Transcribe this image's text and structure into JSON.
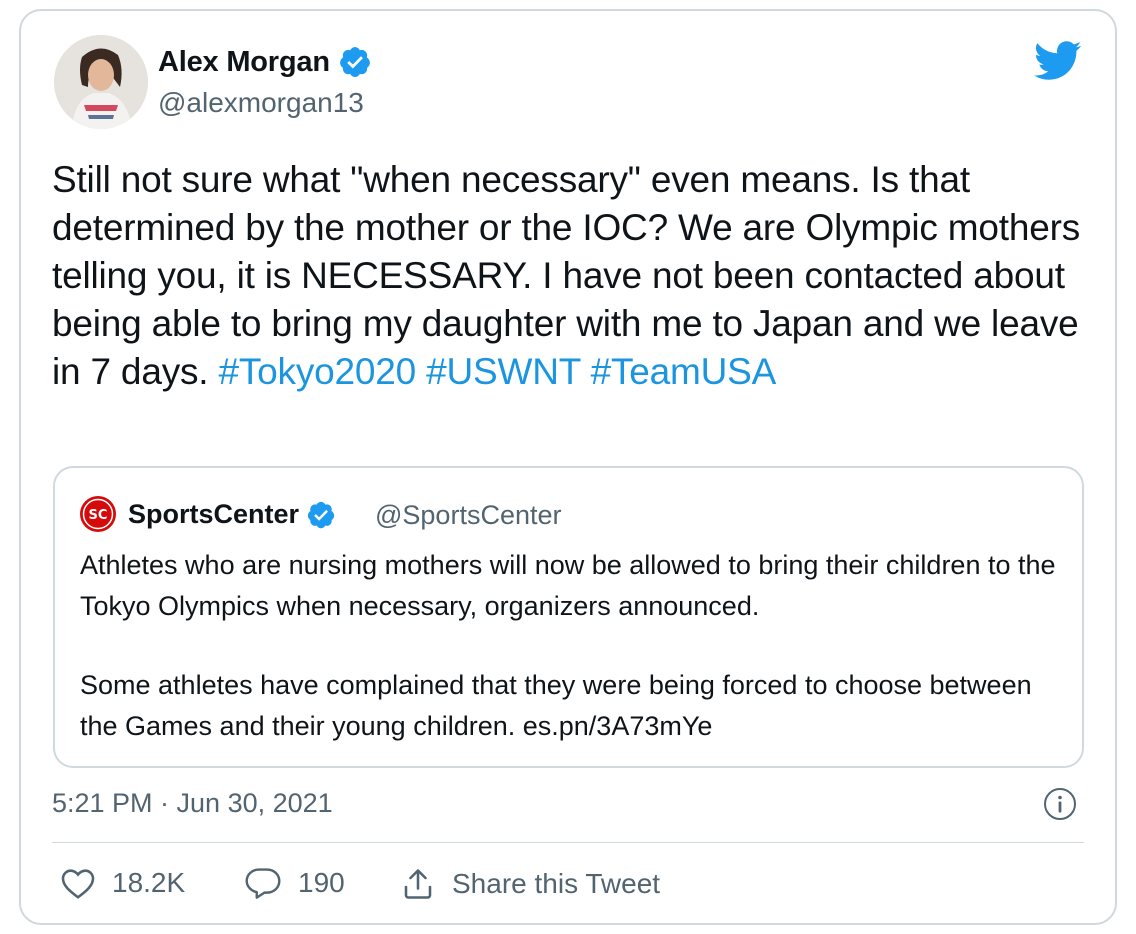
{
  "author": {
    "name": "Alex Morgan",
    "handle": "@alexmorgan13",
    "verified": true
  },
  "tweet": {
    "text_plain": "Still not sure what \"when necessary\" even means. Is that determined by the mother or the IOC? We are Olympic mothers telling you, it is NECESSARY. I have not been contacted about being able to bring my daughter with me to Japan and we leave in 7 days.",
    "hashtags": [
      "#Tokyo2020",
      "#USWNT",
      "#TeamUSA"
    ],
    "timestamp": "5:21 PM · Jun 30, 2021"
  },
  "quoted_tweet": {
    "name": "SportsCenter",
    "handle": "@SportsCenter",
    "verified": true,
    "paragraph_1": "Athletes who are nursing mothers will now be allowed to bring their children to the Tokyo Olympics when necessary, organizers announced.",
    "paragraph_2": "Some athletes have complained that they were being forced to choose between the Games and their young children. es.pn/3A73mYe"
  },
  "actions": {
    "likes": "18.2K",
    "replies": "190",
    "share_label": "Share this Tweet"
  },
  "colors": {
    "text": "#0f1419",
    "secondary": "#536471",
    "accent": "#1b95e0",
    "verified": "#1d9bf0",
    "border": "#cfd9de",
    "espn_red": "#d50a0a"
  },
  "icons": [
    "verified-badge-icon",
    "twitter-bird-icon",
    "sportscenter-logo-icon",
    "info-icon",
    "heart-icon",
    "reply-bubble-icon",
    "share-icon"
  ]
}
